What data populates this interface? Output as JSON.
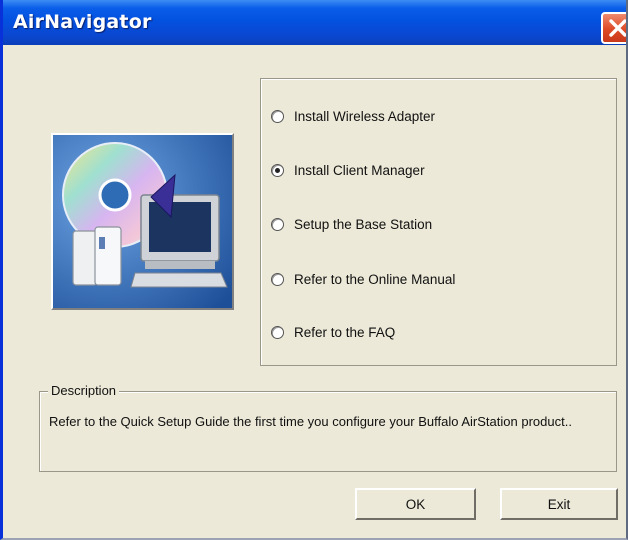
{
  "window": {
    "title": "AirNavigator"
  },
  "options": [
    {
      "label": "Install Wireless Adapter",
      "selected": false
    },
    {
      "label": "Install Client Manager",
      "selected": true
    },
    {
      "label": "Setup the Base Station",
      "selected": false
    },
    {
      "label": "Refer to the Online Manual",
      "selected": false
    },
    {
      "label": "Refer to the FAQ",
      "selected": false
    }
  ],
  "description": {
    "legend": "Description",
    "text": "Refer to the Quick Setup Guide the first time you configure your Buffalo AirStation product.."
  },
  "buttons": {
    "ok": "OK",
    "exit": "Exit"
  },
  "icons": {
    "close": "close-icon",
    "artwork": "computer-cd-install-illustration"
  },
  "colors": {
    "titlebar": "#0a5ee8",
    "close": "#de4a26",
    "dialog_bg": "#ece9d8"
  }
}
